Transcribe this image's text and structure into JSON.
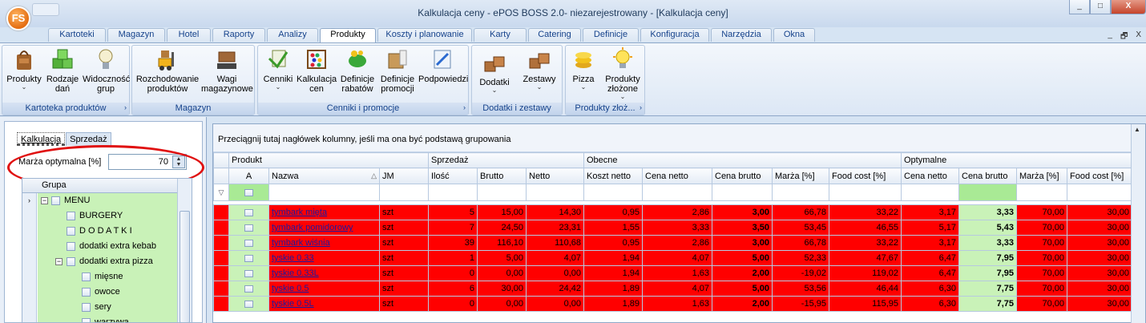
{
  "window": {
    "title": "Kalkulacja ceny - ePOS BOSS 2.0- niezarejestrowany - [Kalkulacja ceny]",
    "logo": "FS",
    "controls": [
      "_",
      "□",
      "X"
    ],
    "mdi_controls": [
      "_",
      "🗗",
      "X"
    ]
  },
  "tabs": [
    {
      "label": "Kartoteki"
    },
    {
      "label": "Magazyn"
    },
    {
      "label": "Hotel"
    },
    {
      "label": "Raporty"
    },
    {
      "label": "Analizy"
    },
    {
      "label": "Produkty"
    },
    {
      "label": "Koszty i planowanie"
    },
    {
      "label": "Karty"
    },
    {
      "label": "Catering"
    },
    {
      "label": "Definicje"
    },
    {
      "label": "Konfiguracja"
    },
    {
      "label": "Narzędzia"
    },
    {
      "label": "Okna"
    }
  ],
  "active_tab": "Produkty",
  "ribbon": {
    "groups": [
      {
        "title": "Kartoteka produktów",
        "buttons": [
          {
            "label": "Produkty",
            "icon": "bag-icon",
            "dropdown": true
          },
          {
            "label": "Rodzaje dań",
            "icon": "cubes-icon",
            "dropdown": false
          },
          {
            "label": "Widoczność grup",
            "icon": "bulb-icon",
            "dropdown": false
          }
        ]
      },
      {
        "title": "Magazyn",
        "buttons": [
          {
            "label": "Rozchodowanie produktów",
            "icon": "forklift-icon",
            "dropdown": false
          },
          {
            "label": "Wagi magazynowe",
            "icon": "scale-icon",
            "dropdown": false
          }
        ]
      },
      {
        "title": "Cenniki i promocje",
        "buttons": [
          {
            "label": "Cenniki",
            "icon": "pricelist-icon",
            "dropdown": true
          },
          {
            "label": "Kalkulacja cen",
            "icon": "abacus-icon",
            "dropdown": false
          },
          {
            "label": "Definicje rabatów",
            "icon": "piggybank-icon",
            "dropdown": false
          },
          {
            "label": "Definicje promocji",
            "icon": "promo-box-icon",
            "dropdown": false
          },
          {
            "label": "Podpowiedzi",
            "icon": "hint-icon",
            "dropdown": false
          }
        ]
      },
      {
        "title": "Dodatki i zestawy",
        "buttons": [
          {
            "label": "Dodatki",
            "icon": "boxes-icon",
            "dropdown": true
          },
          {
            "label": "Zestawy",
            "icon": "boxes-icon",
            "dropdown": true
          }
        ]
      },
      {
        "title": "Produkty złoż...",
        "buttons": [
          {
            "label": "Pizza",
            "icon": "coins-icon",
            "dropdown": true
          },
          {
            "label": "Produkty złożone",
            "icon": "lightbulb-icon",
            "dropdown": true
          }
        ]
      }
    ]
  },
  "left_panel": {
    "tabs": [
      "Kalkulacja",
      "Sprzedaż"
    ],
    "active_tab": "Kalkulacja",
    "marza_label": "Marża optymalna [%]",
    "marza_value": "70",
    "tree_header": "Grupa",
    "tree": [
      {
        "label": "MENU",
        "level": 0,
        "expandable": true,
        "expanded": true,
        "current": true
      },
      {
        "label": "BURGERY",
        "level": 1,
        "expandable": false
      },
      {
        "label": "D O D A T K I",
        "level": 1,
        "expandable": false
      },
      {
        "label": "dodatki extra kebab",
        "level": 1,
        "expandable": false
      },
      {
        "label": "dodatki extra pizza",
        "level": 1,
        "expandable": true,
        "expanded": true
      },
      {
        "label": "mięsne",
        "level": 2,
        "expandable": false
      },
      {
        "label": "owoce",
        "level": 2,
        "expandable": false
      },
      {
        "label": "sery",
        "level": 2,
        "expandable": false
      },
      {
        "label": "warzywa",
        "level": 2,
        "expandable": false
      }
    ]
  },
  "grid": {
    "group_by_hint": "Przeciągnij tutaj nagłówek kolumny, jeśli ma ona być podstawą grupowania",
    "bands": [
      "Produkt",
      "Sprzedaż",
      "Obecne",
      "Optymalne"
    ],
    "columns": [
      "A",
      "Nazwa",
      "JM",
      "Ilość",
      "Brutto",
      "Netto",
      "Koszt netto",
      "Cena netto",
      "Cena brutto",
      "Marża [%]",
      "Food cost [%]",
      "Cena netto",
      "Cena brutto",
      "Marża [%]",
      "Food cost [%]"
    ],
    "sort_indicator": "△",
    "rows": [
      {
        "nazwa": "tymbark mięta",
        "jm": "szt",
        "ilosc": "5",
        "brutto": "15,00",
        "netto": "14,30",
        "koszt": "0,95",
        "cena_netto": "2,86",
        "cena_brutto": "3,00",
        "marza": "66,78",
        "food": "33,22",
        "opt_netto": "3,17",
        "opt_brutto": "3,33",
        "opt_marza": "70,00",
        "opt_food": "30,00"
      },
      {
        "nazwa": "tymbark pomidorowy",
        "jm": "szt",
        "ilosc": "7",
        "brutto": "24,50",
        "netto": "23,31",
        "koszt": "1,55",
        "cena_netto": "3,33",
        "cena_brutto": "3,50",
        "marza": "53,45",
        "food": "46,55",
        "opt_netto": "5,17",
        "opt_brutto": "5,43",
        "opt_marza": "70,00",
        "opt_food": "30,00"
      },
      {
        "nazwa": "tymbark wiśnia",
        "jm": "szt",
        "ilosc": "39",
        "brutto": "116,10",
        "netto": "110,68",
        "koszt": "0,95",
        "cena_netto": "2,86",
        "cena_brutto": "3,00",
        "marza": "66,78",
        "food": "33,22",
        "opt_netto": "3,17",
        "opt_brutto": "3,33",
        "opt_marza": "70,00",
        "opt_food": "30,00"
      },
      {
        "nazwa": "tyskie 0.33",
        "jm": "szt",
        "ilosc": "1",
        "brutto": "5,00",
        "netto": "4,07",
        "koszt": "1,94",
        "cena_netto": "4,07",
        "cena_brutto": "5,00",
        "marza": "52,33",
        "food": "47,67",
        "opt_netto": "6,47",
        "opt_brutto": "7,95",
        "opt_marza": "70,00",
        "opt_food": "30,00"
      },
      {
        "nazwa": "tyskie 0.33L",
        "jm": "szt",
        "ilosc": "0",
        "brutto": "0,00",
        "netto": "0,00",
        "koszt": "1,94",
        "cena_netto": "1,63",
        "cena_brutto": "2,00",
        "marza": "-19,02",
        "food": "119,02",
        "opt_netto": "6,47",
        "opt_brutto": "7,95",
        "opt_marza": "70,00",
        "opt_food": "30,00"
      },
      {
        "nazwa": "tyskie 0.5",
        "jm": "szt",
        "ilosc": "6",
        "brutto": "30,00",
        "netto": "24,42",
        "koszt": "1,89",
        "cena_netto": "4,07",
        "cena_brutto": "5,00",
        "marza": "53,56",
        "food": "46,44",
        "opt_netto": "6,30",
        "opt_brutto": "7,75",
        "opt_marza": "70,00",
        "opt_food": "30,00"
      },
      {
        "nazwa": "tyskie 0.5L",
        "jm": "szt",
        "ilosc": "0",
        "brutto": "0,00",
        "netto": "0,00",
        "koszt": "1,89",
        "cena_netto": "1,63",
        "cena_brutto": "2,00",
        "marza": "-15,95",
        "food": "115,95",
        "opt_netto": "6,30",
        "opt_brutto": "7,75",
        "opt_marza": "70,00",
        "opt_food": "30,00"
      }
    ]
  }
}
